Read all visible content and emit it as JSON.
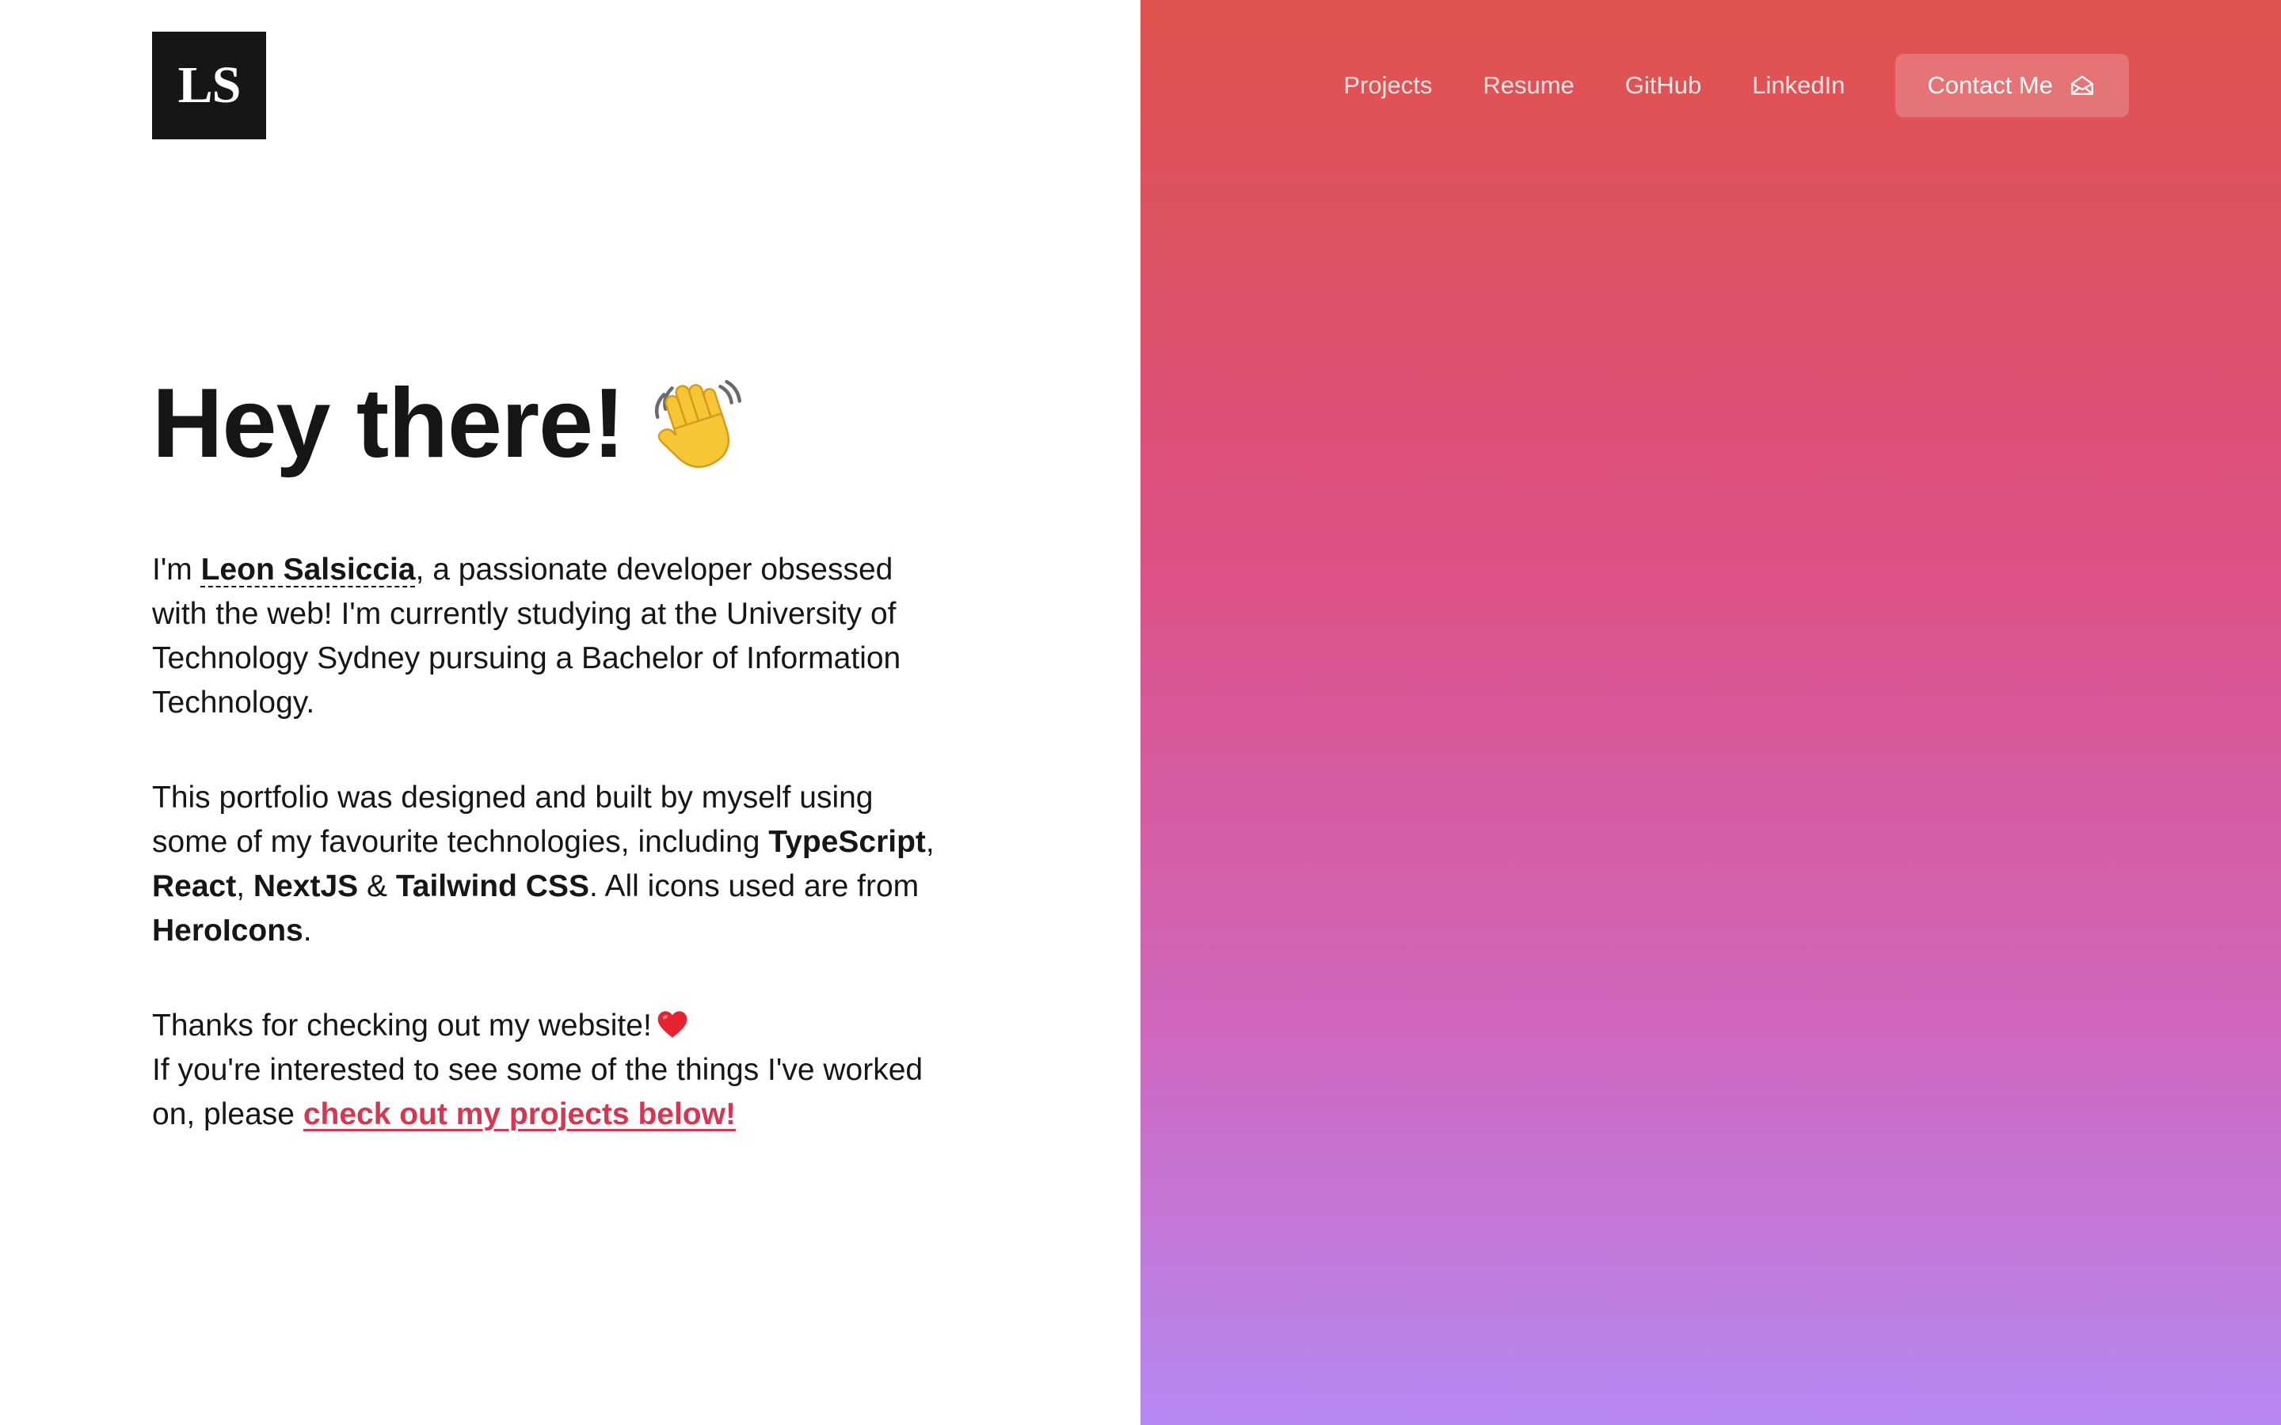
{
  "logo": {
    "text": "LS"
  },
  "nav": {
    "links": [
      "Projects",
      "Resume",
      "GitHub",
      "LinkedIn"
    ],
    "contact_label": "Contact Me",
    "contact_icon": "envelope-open-icon"
  },
  "hero": {
    "headline": "Hey there!",
    "headline_icon": "waving-hand-icon",
    "intro": {
      "before_name": "I'm ",
      "name": "Leon Salsiccia",
      "after_name": ", a passionate developer obsessed with the web! I'm currently studying at the University of Technology Sydney pursuing a Bachelor of Information Technology."
    },
    "stack": {
      "text1": "This portfolio was designed and built by myself using some of my favourite technologies, including ",
      "tech1": "TypeScript",
      "sep1": ", ",
      "tech2": "React",
      "sep2": ", ",
      "tech3": "NextJS",
      "sep3": " & ",
      "tech4": "Tailwind CSS",
      "text2": ". All icons used are from ",
      "icons_source": "HeroIcons",
      "text3": "."
    },
    "thanks": {
      "line1": "Thanks for checking out my website!",
      "line1_icon": "heart-icon",
      "line2_before": "If you're interested to see some of the things I've worked on, please ",
      "link": "check out my projects below!"
    }
  },
  "colors": {
    "gradient_top": "#e0524c",
    "gradient_middle": "#dc5186",
    "gradient_bottom": "#b688f2",
    "link_accent": "#d63650",
    "text": "#161616"
  }
}
